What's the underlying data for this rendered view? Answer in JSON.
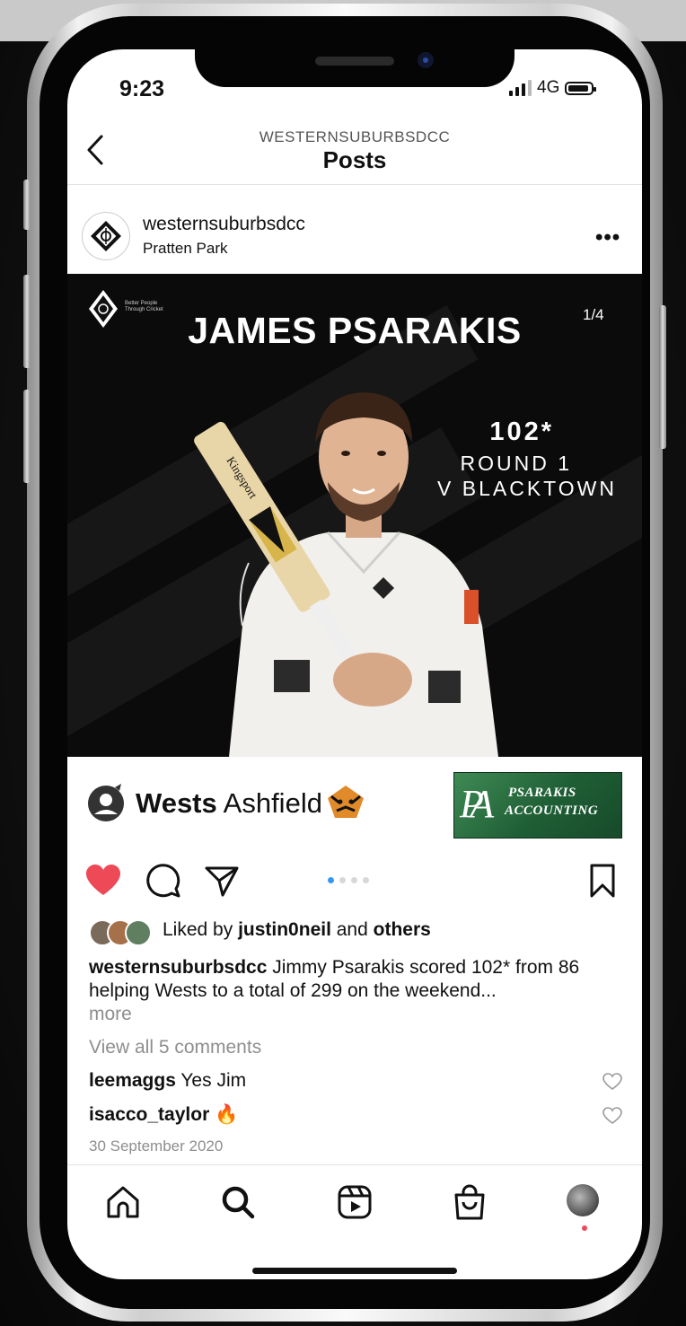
{
  "status_bar": {
    "time": "9:23",
    "network": "4G"
  },
  "header": {
    "account": "WESTERNSUBURBSDCC",
    "title": "Posts"
  },
  "post": {
    "username": "westernsuburbsdcc",
    "location": "Pratten Park",
    "image": {
      "club_tagline": "Better People Through Cricket",
      "player_name": "JAMES PSARAKIS",
      "counter": "1/4",
      "score": "102*",
      "round": "ROUND 1",
      "opponent": "V BLACKTOWN",
      "bat_brand": "Kingsport"
    },
    "sponsors": {
      "wests_bold": "Wests",
      "wests_rest": "Ashfield",
      "pa_monogram": "PA",
      "pa_line1": "PSARAKIS",
      "pa_line2": "ACCOUNTING"
    },
    "carousel": {
      "count": 4,
      "active": 0
    },
    "liked_by": {
      "prefix": "Liked by ",
      "user": "justin0neil",
      "middle": " and ",
      "others": "others"
    },
    "caption": {
      "username": "westernsuburbsdcc",
      "text": " Jimmy Psarakis scored 102* from 86 helping Wests to a total of 299 on the weekend...",
      "more": "more"
    },
    "view_comments": "View all 5 comments",
    "comments": [
      {
        "user": "leemaggs",
        "text": " Yes Jim"
      },
      {
        "user": "isacco_taylor",
        "text": " 🔥"
      }
    ],
    "date": "30 September 2020"
  },
  "colors": {
    "like_red": "#ed4956",
    "carousel_blue": "#3897f0",
    "pa_green": "#1f5e35"
  },
  "icons": [
    "back-icon",
    "more-icon",
    "heart-icon",
    "comment-icon",
    "share-icon",
    "bookmark-icon",
    "home-icon",
    "search-icon",
    "reels-icon",
    "shop-icon",
    "profile-avatar"
  ]
}
